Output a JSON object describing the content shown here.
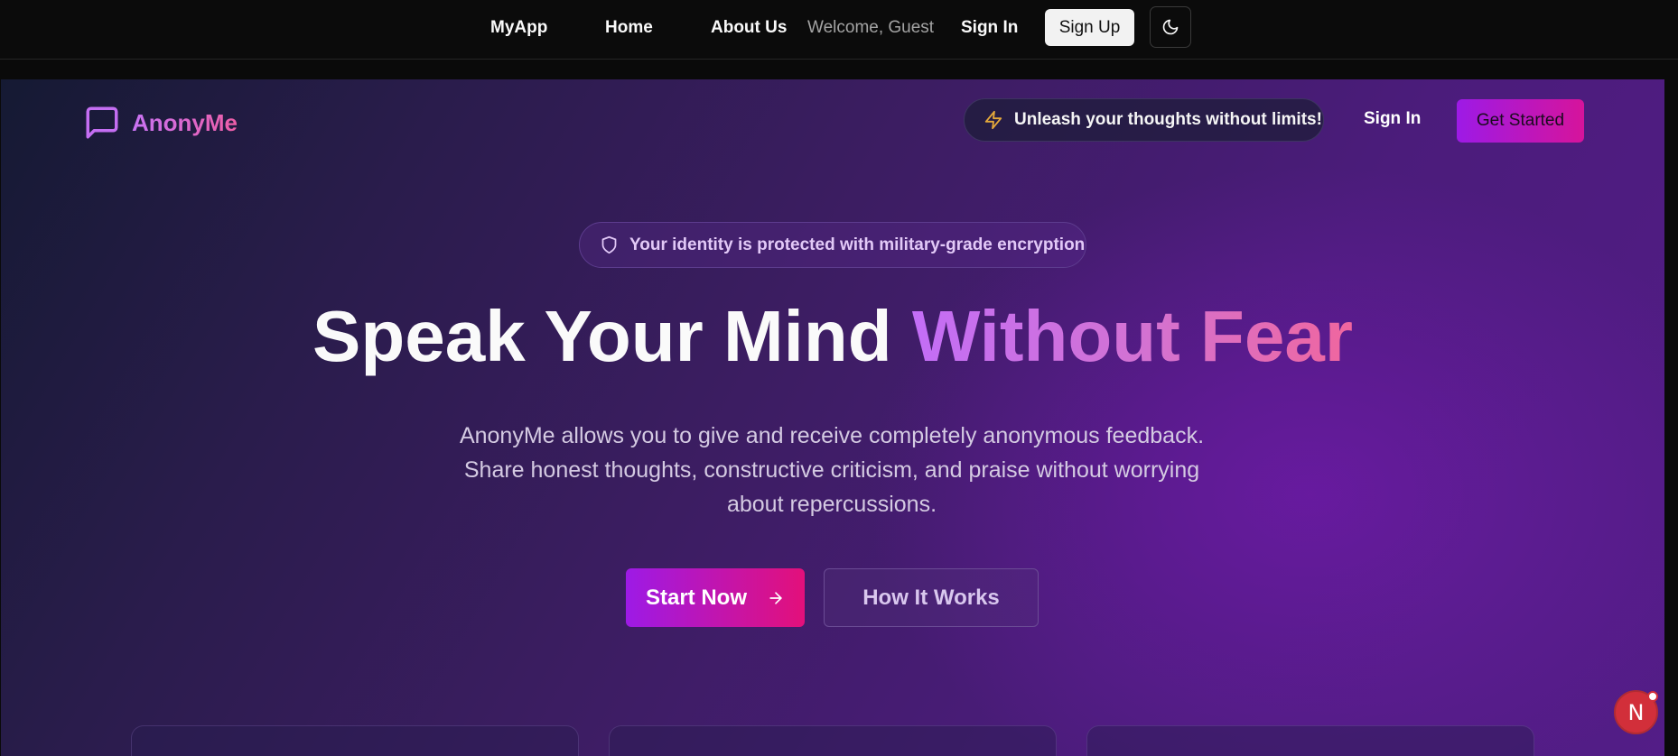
{
  "topnav": {
    "brand": "MyApp",
    "home": "Home",
    "about": "About Us",
    "welcome": "Welcome, Guest",
    "signin": "Sign In",
    "signup": "Sign Up",
    "theme_icon": "moon-icon"
  },
  "hero": {
    "logo_text": "AnonyMe",
    "logo_icon": "message-square-icon",
    "tagline": "Unleash your thoughts without limits!",
    "tagline_icon": "lightning-bolt-icon",
    "signin": "Sign In",
    "get_started": "Get Started",
    "security_badge": "Your identity is protected with military-grade encryption",
    "security_icon": "shield-icon",
    "headline_plain": "Speak Your Mind ",
    "headline_accent": "Without Fear",
    "subtitle_line1": "AnonyMe allows you to give and receive completely anonymous feedback.",
    "subtitle_line2": "Share honest thoughts, constructive criticism, and praise without worrying",
    "subtitle_line3": "about repercussions.",
    "start_now": "Start Now",
    "start_now_icon": "arrow-right-icon",
    "how_it_works": "How It Works"
  },
  "dev_badge": {
    "letter": "N"
  },
  "colors": {
    "accent_purple": "#9d1ae6",
    "accent_pink": "#e3107a",
    "logo_gradient_start": "#c873f5",
    "logo_gradient_end": "#ee5ea7"
  }
}
